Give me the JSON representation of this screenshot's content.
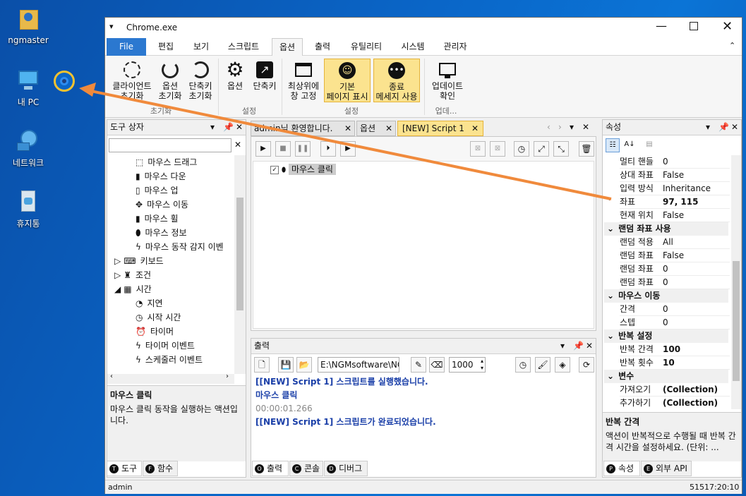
{
  "desktop": {
    "icons": [
      {
        "label": "ngmaster"
      },
      {
        "label": "내 PC"
      },
      {
        "label": "네트워크"
      },
      {
        "label": "휴지통"
      }
    ]
  },
  "window": {
    "title": "Chrome.exe",
    "menu": [
      "File",
      "편집",
      "보기",
      "스크립트",
      "옵션",
      "출력",
      "유틸리티",
      "시스템",
      "관리자"
    ],
    "ribbon": {
      "btn_client_reset": "클라이언트\n초기화",
      "btn_option_reset": "옵션\n초기화",
      "btn_hotkey_reset": "단축키\n초기화",
      "group_reset": "초기화",
      "btn_options": "옵션",
      "btn_hotkeys": "단축키",
      "group_settings1": "설정",
      "btn_topmost": "최상위에\n창 고정",
      "btn_default_page": "기본\n페이지 표시",
      "btn_exit_msg": "종료\n메세지 사용",
      "group_settings2": "설정",
      "btn_update": "업데이트\n확인",
      "group_update": "업데..."
    },
    "toolbox": {
      "title": "도구 상자",
      "items": [
        {
          "label": "마우스 드래그"
        },
        {
          "label": "마우스 다운"
        },
        {
          "label": "마우스 업"
        },
        {
          "label": "마우스 이동"
        },
        {
          "label": "마우스 휠"
        },
        {
          "label": "마우스 정보"
        },
        {
          "label": "마우스 동작 감지 이벤"
        },
        {
          "label": "키보드"
        },
        {
          "label": "조건"
        },
        {
          "label": "시간"
        },
        {
          "label": "지연"
        },
        {
          "label": "시작 시간"
        },
        {
          "label": "타이머"
        },
        {
          "label": "타이머 이벤트"
        },
        {
          "label": "스케줄러 이벤트"
        }
      ],
      "desc_title": "마우스 클릭",
      "desc_text": "마우스 클릭 동작을 실행하는 액션입니다.",
      "tab_tools": "도구",
      "tab_funcs": "함수"
    },
    "editor": {
      "tabs": [
        "admin님 환영합니다.",
        "옵션",
        "[NEW] Script 1"
      ],
      "item_label": "마우스 클릭"
    },
    "output": {
      "title": "출력",
      "path": "E:\\NGMsoftware\\NG",
      "number": "1000",
      "lines": [
        {
          "text": "[[NEW] Script 1] 스크립트를 실행했습니다.",
          "color": "#1a3fa8"
        },
        {
          "text": "마우스 클릭",
          "color": "#1a3fa8"
        },
        {
          "text": "00:00:01.266",
          "color": "#888888"
        },
        {
          "text": "[[NEW] Script 1] 스크립트가 완료되었습니다.",
          "color": "#1a3fa8"
        }
      ],
      "tab_output": "출력",
      "tab_console": "콘솔",
      "tab_debug": "디버그"
    },
    "properties": {
      "title": "속성",
      "rows": [
        {
          "name": "멀티 핸들",
          "value": "0",
          "bold": false,
          "section": false
        },
        {
          "name": "상대 좌표",
          "value": "False",
          "bold": false,
          "section": false
        },
        {
          "name": "입력 방식",
          "value": "Inheritance",
          "bold": false,
          "section": false
        },
        {
          "name": "좌표",
          "value": "97, 115",
          "bold": true,
          "section": false
        },
        {
          "name": "현재 위치",
          "value": "False",
          "bold": false,
          "section": false
        },
        {
          "name": "랜덤 좌표 사용",
          "value": "",
          "bold": true,
          "section": true
        },
        {
          "name": "랜덤 적용",
          "value": "All",
          "bold": false,
          "section": false
        },
        {
          "name": "랜덤 좌표",
          "value": "False",
          "bold": false,
          "section": false
        },
        {
          "name": "랜덤 좌표",
          "value": "0",
          "bold": false,
          "section": false
        },
        {
          "name": "랜덤 좌표",
          "value": "0",
          "bold": false,
          "section": false
        },
        {
          "name": "마우스 이동",
          "value": "",
          "bold": true,
          "section": true
        },
        {
          "name": "간격",
          "value": "0",
          "bold": false,
          "section": false
        },
        {
          "name": "스텝",
          "value": "0",
          "bold": false,
          "section": false
        },
        {
          "name": "반복 설정",
          "value": "",
          "bold": true,
          "section": true
        },
        {
          "name": "반복 간격",
          "value": "100",
          "bold": true,
          "section": false
        },
        {
          "name": "반복 횟수",
          "value": "10",
          "bold": true,
          "section": false
        },
        {
          "name": "변수",
          "value": "",
          "bold": true,
          "section": true
        },
        {
          "name": "가져오기",
          "value": "(Collection)",
          "bold": true,
          "section": false
        },
        {
          "name": "추가하기",
          "value": "(Collection)",
          "bold": true,
          "section": false
        }
      ],
      "desc_title": "반복 간격",
      "desc_text": "액션이 반복적으로 수행될 때 반복 간격 시간을 설정하세요. (단위: ...",
      "tab_props": "속성",
      "tab_api": "외부 API"
    },
    "status": {
      "user": "admin",
      "time": "51517:20:10"
    }
  },
  "colors": {
    "arrow": "#f08a3c",
    "file_menu": "#2b78d0",
    "highlight": "#fbe38f"
  }
}
